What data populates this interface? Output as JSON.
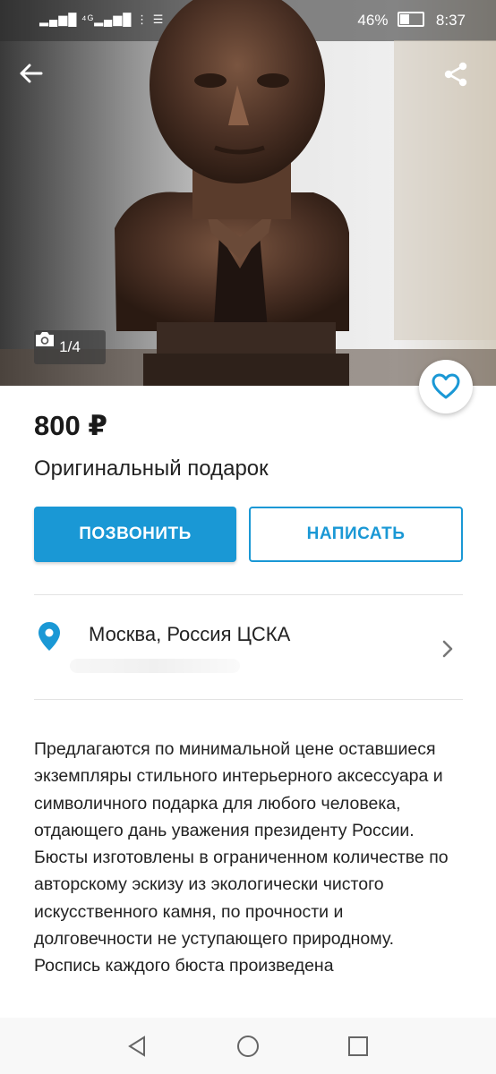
{
  "status_bar": {
    "signal": "▂▄▆█ ⁴ᴳ▂▄▆█ ⋮ ☰",
    "battery_percent": "46%",
    "time": "8:37"
  },
  "gallery": {
    "counter": "1/4",
    "current": 1,
    "total": 4
  },
  "listing": {
    "price": "800 ₽",
    "title": "Оригинальный подарок"
  },
  "actions": {
    "call_label": "ПОЗВОНИТЬ",
    "write_label": "НАПИСАТЬ"
  },
  "location": {
    "text": "Москва, Россия ЦСКА"
  },
  "description": "Предлагаются по минимальной цене оставшиеся экземпляры стильного интерьерного аксессуара и символичного подарка для любого человека, отдающего дань уважения президенту России. Бюсты изготовлены в ограниченном количестве по авторскому эскизу из экологически чистого искусственного камня, по прочности и долговечности не уступающего природному. Роспись каждого бюста произведена",
  "icons": {
    "back": "arrow-left-icon",
    "share": "share-icon",
    "camera": "camera-icon",
    "favorite": "heart-icon",
    "location": "map-pin-icon",
    "chevron": "chevron-right-icon"
  },
  "colors": {
    "accent": "#1a98d5",
    "price_text": "#1a1a1a"
  }
}
